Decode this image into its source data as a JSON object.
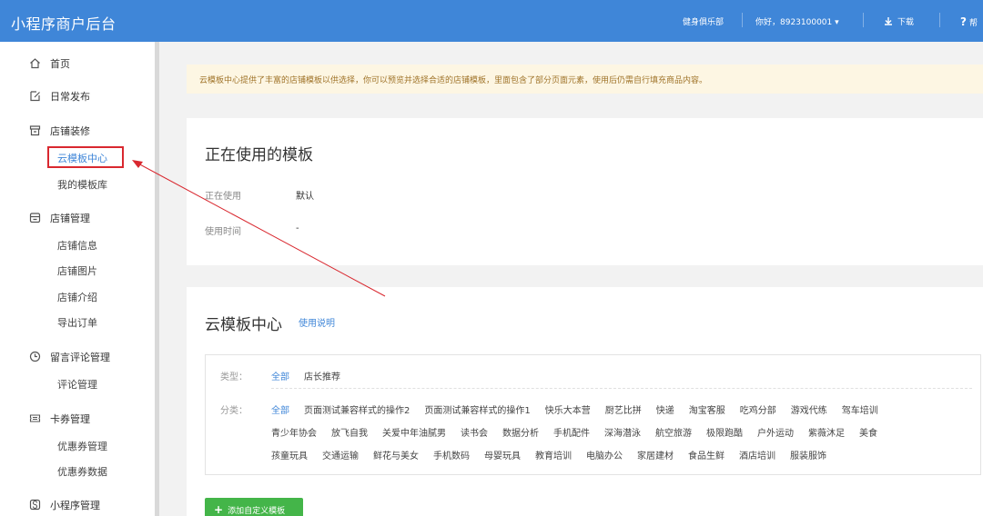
{
  "header": {
    "brand": "小程序商户后台",
    "store": "健身俱乐部",
    "greeting": "你好，8923100001 ▾",
    "download": "下载",
    "help": "帮"
  },
  "sidebar": {
    "groups": [
      {
        "label": "首页",
        "icon": "home-icon"
      },
      {
        "label": "日常发布",
        "icon": "edit-icon"
      },
      {
        "label": "店铺装修",
        "icon": "shop-icon"
      },
      {
        "label": "店铺管理",
        "icon": "store-manage-icon"
      },
      {
        "label": "留言评论管理",
        "icon": "clock-icon"
      },
      {
        "label": "卡券管理",
        "icon": "ticket-icon"
      },
      {
        "label": "小程序管理",
        "icon": "app-icon"
      }
    ],
    "sub": {
      "decorate": [
        "云模板中心",
        "我的模板库"
      ],
      "store": [
        "店铺信息",
        "店铺图片",
        "店铺介绍",
        "导出订单"
      ],
      "comment": [
        "评论管理"
      ],
      "coupon": [
        "优惠券管理",
        "优惠券数据"
      ]
    }
  },
  "notice": "云模板中心提供了丰富的店铺模板以供选择，你可以预览并选择合适的店铺模板，里面包含了部分页面元素，使用后仍需自行填充商品内容。",
  "current": {
    "title": "正在使用的模板",
    "rows": [
      {
        "label": "正在使用",
        "value": "默认"
      },
      {
        "label": "使用时间",
        "value": "-"
      }
    ]
  },
  "cloud": {
    "title": "云模板中心",
    "help_link": "使用说明",
    "type_label": "类型：",
    "types": [
      "全部",
      "店长推荐"
    ],
    "category_label": "分类：",
    "categories_line1": [
      "全部",
      "页面测试兼容样式的操作2",
      "页面测试兼容样式的操作1",
      "快乐大本营",
      "厨艺比拼",
      "快递",
      "淘宝客服",
      "吃鸡分部",
      "游戏代练",
      "驾车培训"
    ],
    "categories_line2": [
      "青少年协会",
      "放飞自我",
      "关爱中年油腻男",
      "读书会",
      "数据分析",
      "手机配件",
      "深海潜泳",
      "航空旅游",
      "极限跑酷",
      "户外运动",
      "紫薇沐足",
      "美食"
    ],
    "categories_line3": [
      "孩童玩具",
      "交通运输",
      "鲜花与美女",
      "手机数码",
      "母婴玩具",
      "教育培训",
      "电脑办公",
      "家居建材",
      "食品生鲜",
      "酒店培训",
      "服装服饰"
    ],
    "add_button": "添加自定义模板"
  },
  "colors": {
    "primary": "#3f86d8",
    "highlight": "#d9282f",
    "success": "#44b549",
    "notice_bg": "#fdf6e3"
  }
}
